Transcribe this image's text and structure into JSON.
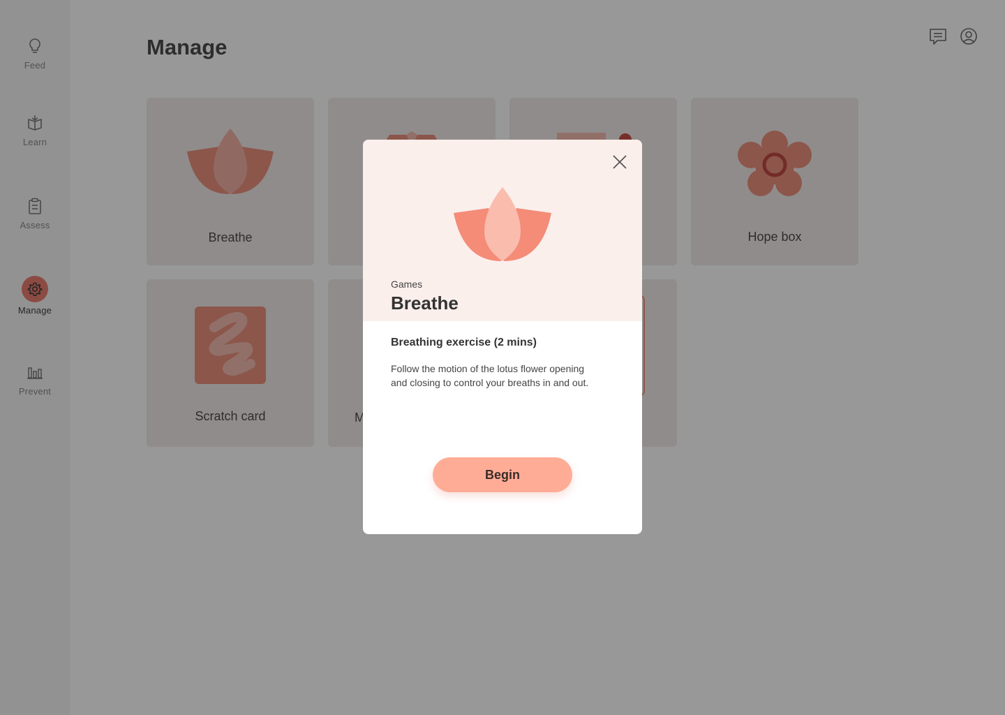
{
  "sidebar": {
    "items": [
      {
        "label": "Feed",
        "icon": "lightbulb-icon"
      },
      {
        "label": "Learn",
        "icon": "book-icon"
      },
      {
        "label": "Assess",
        "icon": "clipboard-icon"
      },
      {
        "label": "Manage",
        "icon": "gear-icon",
        "active": true
      },
      {
        "label": "Prevent",
        "icon": "bar-chart-icon"
      }
    ]
  },
  "header": {
    "title": "Manage",
    "icons": [
      "chat-icon",
      "profile-icon"
    ]
  },
  "tiles": [
    {
      "label": "Breathe",
      "icon": "lotus-icon"
    },
    {
      "label": "",
      "icon": "gem-icon"
    },
    {
      "label": "",
      "icon": "card-icon"
    },
    {
      "label": "Hope box",
      "icon": "flower-icon"
    },
    {
      "label": "Scratch card",
      "icon": "scratch-icon"
    },
    {
      "label": "M",
      "icon": ""
    },
    {
      "label": "",
      "icon": ""
    }
  ],
  "modal": {
    "category": "Games",
    "title": "Breathe",
    "subtitle": "Breathing exercise (2 mins)",
    "description": "Follow the motion of the lotus flower opening and closing to control your breaths in and out.",
    "button_label": "Begin"
  },
  "colors": {
    "accent": "#e86b5a",
    "tile_bg": "#efe8e6",
    "modal_header_bg": "#fbefec",
    "button_bg": "#ffac97"
  }
}
